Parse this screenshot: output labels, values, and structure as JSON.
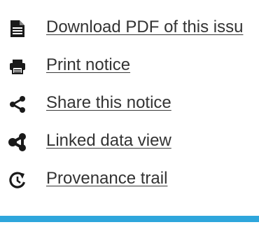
{
  "links": [
    {
      "label": "Download PDF of this issu",
      "icon": "document-icon"
    },
    {
      "label": "Print notice",
      "icon": "printer-icon"
    },
    {
      "label": "Share this notice",
      "icon": "share-icon"
    },
    {
      "label": "Linked data view",
      "icon": "linked-data-icon"
    },
    {
      "label": "Provenance trail",
      "icon": "provenance-icon"
    }
  ],
  "colors": {
    "text": "#333333",
    "icon": "#1a1a1a",
    "accent_bar": "#2ea6dc"
  }
}
